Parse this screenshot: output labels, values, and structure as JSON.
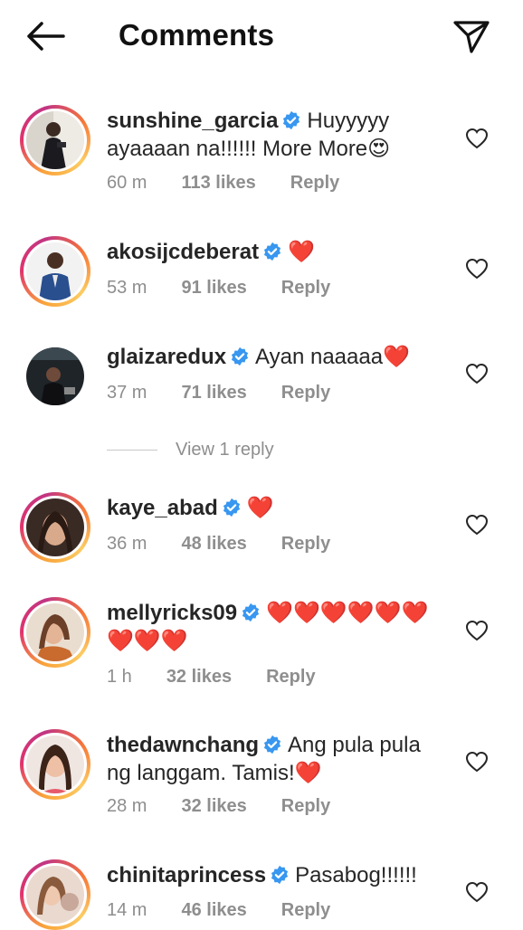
{
  "header": {
    "title": "Comments"
  },
  "view_reply_label": "View 1 reply",
  "comments": [
    {
      "username": "sunshine_garcia",
      "text": "Huyyyyy ayaaaan na!!!!!! More More😍",
      "time": "60 m",
      "likes": "113 likes",
      "reply": "Reply"
    },
    {
      "username": "akosijcdeberat",
      "text": "❤️",
      "time": "53 m",
      "likes": "91 likes",
      "reply": "Reply"
    },
    {
      "username": "glaizaredux",
      "text": "Ayan naaaaa❤️",
      "time": "37 m",
      "likes": "71 likes",
      "reply": "Reply"
    },
    {
      "username": "kaye_abad",
      "text": "❤️",
      "time": "36 m",
      "likes": "48 likes",
      "reply": "Reply"
    },
    {
      "username": "mellyricks09",
      "text": "❤️❤️❤️❤️❤️❤️❤️❤️❤️",
      "time": "1 h",
      "likes": "32 likes",
      "reply": "Reply"
    },
    {
      "username": "thedawnchang",
      "text": "Ang pula pula ng langgam. Tamis!❤️",
      "time": "28 m",
      "likes": "32 likes",
      "reply": "Reply"
    },
    {
      "username": "chinitaprincess",
      "text": "Pasabog!!!!!!",
      "time": "14 m",
      "likes": "46 likes",
      "reply": "Reply"
    }
  ],
  "colors": {
    "verified": "#3897f0",
    "heart": "#ed1c24",
    "meta": "#8e8e8e"
  }
}
